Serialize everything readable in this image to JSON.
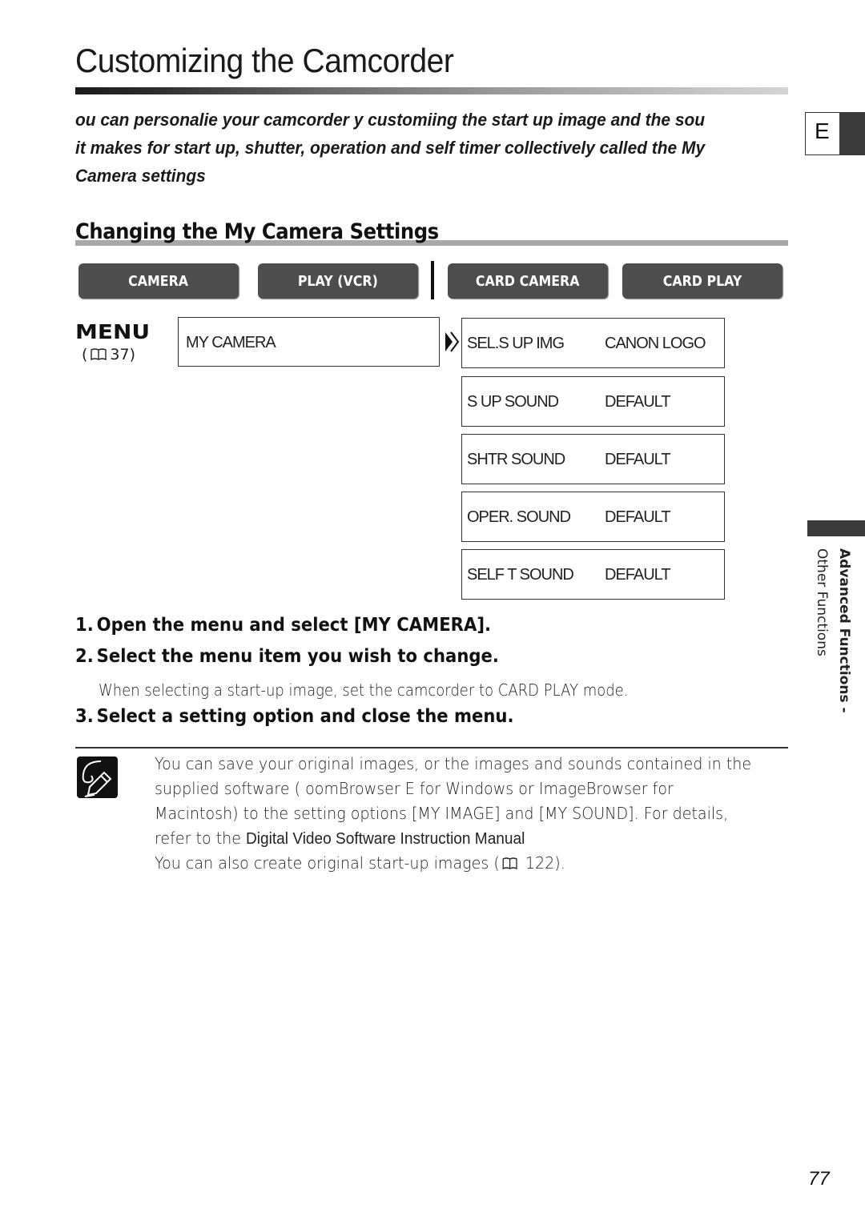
{
  "page": {
    "title": "Customizing the Camcorder",
    "intro_lines": [
      "ou can personalie your camcorder   y customiing the start up image and the sou",
      "it makes for start up, shutter, operation and self timer  collectively called the My",
      "Camera settings"
    ],
    "language_tab": "E",
    "page_number": "77"
  },
  "section": {
    "heading": "Changing the My Camera Settings"
  },
  "modes": {
    "items": [
      {
        "label": "CAMERA"
      },
      {
        "label": "PLAY (VCR)"
      },
      {
        "label": "CARD CAMERA"
      },
      {
        "label": "CARD PLAY"
      }
    ]
  },
  "menu": {
    "label": "MENU",
    "ref_open": "(",
    "ref_page": "37)",
    "item": "MY CAMERA",
    "settings": [
      {
        "name": "SEL.S UP IMG",
        "value": "CANON LOGO"
      },
      {
        "name": "S UP SOUND",
        "value": "DEFAULT"
      },
      {
        "name": "SHTR SOUND",
        "value": "DEFAULT"
      },
      {
        "name": "OPER. SOUND",
        "value": "DEFAULT"
      },
      {
        "name": "SELF T SOUND",
        "value": "DEFAULT"
      }
    ]
  },
  "side": {
    "bold": "Advanced Functions -",
    "normal": "Other Functions"
  },
  "steps": [
    {
      "num": "1.",
      "text": "Open the menu and select [MY CAMERA]."
    },
    {
      "num": "2.",
      "text": "Select the menu item you wish to change.",
      "note": "When selecting a start-up image, set the camcorder to CARD PLAY mode."
    },
    {
      "num": "3.",
      "text": "Select a setting option and close the menu."
    }
  ],
  "note": {
    "line1": "You can save your original images, or the images and sounds contained in the",
    "line2": "supplied software (  oomBrowser E    for Windows or ImageBrowser for",
    "line3": "Macintosh) to the setting options [MY IMAGE] and [MY SOUND]. For details,",
    "line4_prefix": "refer to the ",
    "line4_manual": "Digital Video Software Instruction Manual",
    "line5_prefix": "You can also create original start-up images (",
    "line5_suffix": " 122)."
  },
  "colors": {
    "button_bg": "#4d4d4d",
    "tab_dark": "#3a3a3a",
    "section_bar": "#a8a8a8"
  }
}
